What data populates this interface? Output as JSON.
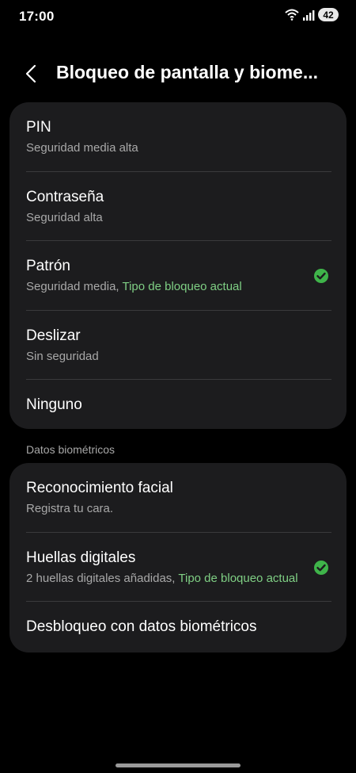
{
  "status_bar": {
    "time": "17:00",
    "battery": "42",
    "icons": [
      "wifi-icon",
      "signal-icon",
      "battery-icon"
    ]
  },
  "header": {
    "title": "Bloqueo de pantalla y biome..."
  },
  "lock_types": [
    {
      "title": "PIN",
      "subtitle": "Seguridad media alta",
      "subtitle_accent": "",
      "selected": false
    },
    {
      "title": "Contraseña",
      "subtitle": "Seguridad alta",
      "subtitle_accent": "",
      "selected": false
    },
    {
      "title": "Patrón",
      "subtitle": "Seguridad media, ",
      "subtitle_accent": "Tipo de bloqueo actual",
      "selected": true
    },
    {
      "title": "Deslizar",
      "subtitle": "Sin seguridad",
      "subtitle_accent": "",
      "selected": false
    },
    {
      "title": "Ninguno",
      "subtitle": "",
      "subtitle_accent": "",
      "selected": false
    }
  ],
  "biometrics": {
    "section_label": "Datos biométricos",
    "items": [
      {
        "title": "Reconocimiento facial",
        "subtitle": "Registra tu cara.",
        "subtitle_accent": "",
        "selected": false
      },
      {
        "title": "Huellas digitales",
        "subtitle": "2 huellas digitales añadidas, ",
        "subtitle_accent": "Tipo de bloqueo actual",
        "selected": true
      },
      {
        "title": "Desbloqueo con datos biométricos",
        "subtitle": "",
        "subtitle_accent": "",
        "selected": false
      }
    ]
  },
  "colors": {
    "background": "#000000",
    "card": "#1c1c1e",
    "accent_green": "#7fcf84",
    "check_green": "#3fb44a",
    "secondary_text": "#a8a8a8"
  }
}
